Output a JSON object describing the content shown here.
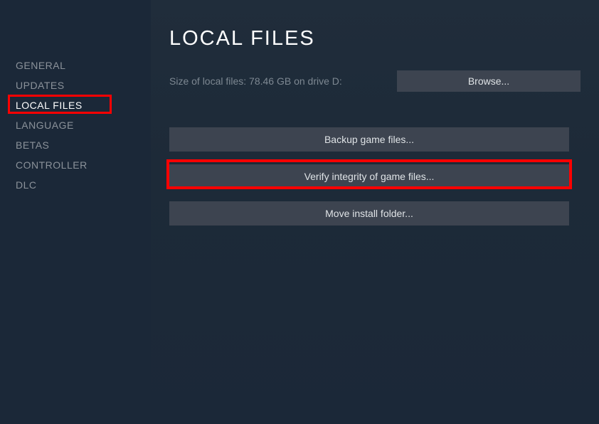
{
  "sidebar": {
    "items": [
      {
        "label": "GENERAL"
      },
      {
        "label": "UPDATES"
      },
      {
        "label": "LOCAL FILES"
      },
      {
        "label": "LANGUAGE"
      },
      {
        "label": "BETAS"
      },
      {
        "label": "CONTROLLER"
      },
      {
        "label": "DLC"
      }
    ],
    "activeIndex": 2
  },
  "main": {
    "title": "LOCAL FILES",
    "sizeText": "Size of local files: 78.46 GB on drive D:",
    "browseLabel": "Browse...",
    "backupLabel": "Backup game files...",
    "verifyLabel": "Verify integrity of game files...",
    "moveLabel": "Move install folder..."
  }
}
